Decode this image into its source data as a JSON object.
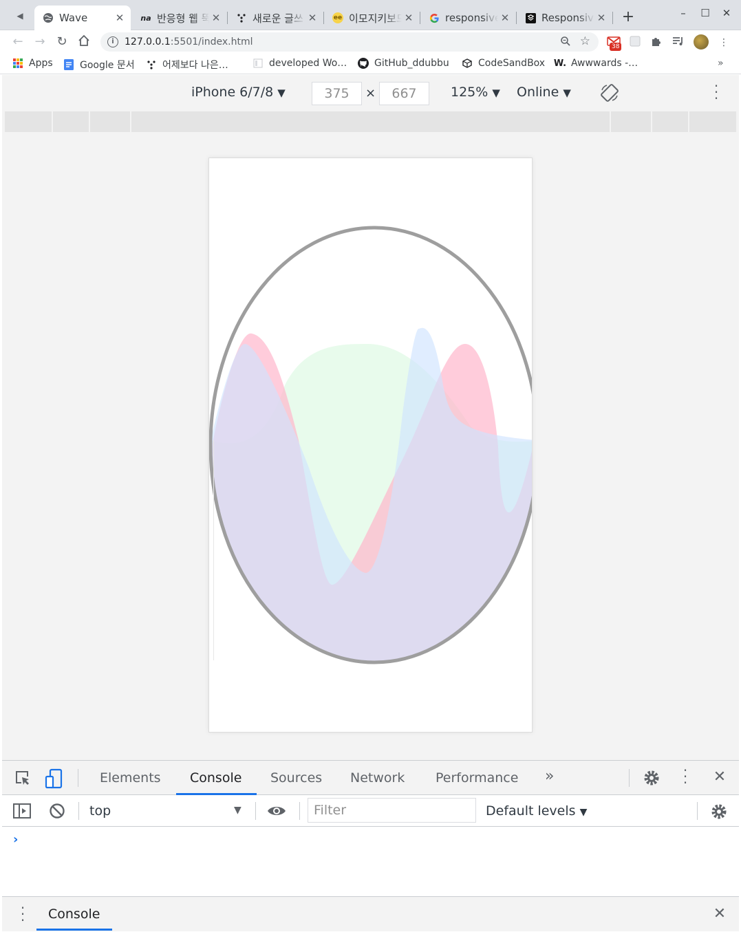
{
  "browser": {
    "tabs": [
      {
        "title": "Wave",
        "icon": "globe-icon",
        "active": true
      },
      {
        "title": "반응형 웹 뚝",
        "icon": "na-favicon-icon"
      },
      {
        "title": "새로운 글쓰",
        "icon": "dots-favicon-icon"
      },
      {
        "title": "이모지키보드",
        "icon": "ee-favicon-icon"
      },
      {
        "title": "responsive",
        "icon": "google-icon"
      },
      {
        "title": "Responsive",
        "icon": "codepen-icon"
      }
    ],
    "url_host": "127.0.0.1",
    "url_rest": ":5501/index.html",
    "mail_badge": "38",
    "bookmarks": [
      {
        "label": "Apps"
      },
      {
        "label": "Google 문서"
      },
      {
        "label": "어제보다 나은…"
      },
      {
        "label": "developed Wo…"
      },
      {
        "label": "GitHub_ddubbu"
      },
      {
        "label": "CodeSandBox"
      },
      {
        "label": "Awwwards -…"
      }
    ]
  },
  "device_toolbar": {
    "device": "iPhone 6/7/8",
    "width": "375",
    "height": "667",
    "zoom": "125%",
    "throttle": "Online"
  },
  "page": {
    "circle_border_color": "#9e9e9e",
    "wave_colors": [
      "#cfe3ff",
      "#ffb6cc",
      "#d6f7dc"
    ]
  },
  "devtools": {
    "tabs": [
      "Elements",
      "Console",
      "Sources",
      "Network",
      "Performance"
    ],
    "active_tab": "Console",
    "context": "top",
    "filter_placeholder": "Filter",
    "levels": "Default levels",
    "drawer_tab": "Console"
  }
}
